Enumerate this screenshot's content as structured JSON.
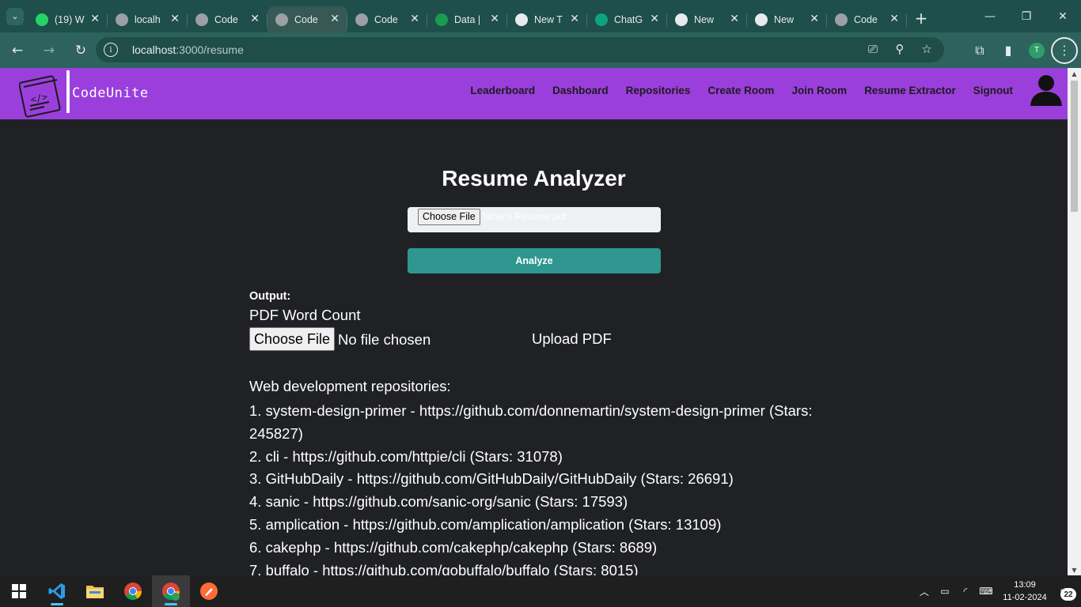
{
  "browser": {
    "tabs": [
      {
        "title": "(19) W",
        "favicon_color": "#25d366",
        "icon": "whatsapp-icon"
      },
      {
        "title": "localh",
        "favicon_color": "#9aa0a6",
        "icon": "globe-icon"
      },
      {
        "title": "Code",
        "favicon_color": "#9aa0a6",
        "icon": "globe-icon"
      },
      {
        "title": "Code",
        "favicon_color": "#9aa0a6",
        "icon": "globe-icon",
        "active": true
      },
      {
        "title": "Code",
        "favicon_color": "#9aa0a6",
        "icon": "globe-icon"
      },
      {
        "title": "Data |",
        "favicon_color": "#1a9c4d",
        "icon": "mongodb-leaf-icon"
      },
      {
        "title": "New T",
        "favicon_color": "#e8eaed",
        "icon": "chrome-icon"
      },
      {
        "title": "ChatG",
        "favicon_color": "#10a37f",
        "icon": "chatgpt-icon"
      },
      {
        "title": "New",
        "favicon_color": "#e8eaed",
        "icon": "chrome-icon"
      },
      {
        "title": "New",
        "favicon_color": "#e8eaed",
        "icon": "chrome-icon"
      },
      {
        "title": "Code",
        "favicon_color": "#9aa0a6",
        "icon": "globe-icon"
      }
    ],
    "url_host": "localhost",
    "url_path": ":3000/resume",
    "profile_initial": "T"
  },
  "app": {
    "brand": "CodeUnite",
    "nav_links": [
      "Leaderboard",
      "Dashboard",
      "Repositories",
      "Create Room",
      "Join Room",
      "Resume Extractor",
      "Signout"
    ],
    "accent_color": "#9b3fdc"
  },
  "page": {
    "title": "Resume Analyzer",
    "file_button_label": "Choose File",
    "selected_file": "Taher's Resume.pdf",
    "analyze_label": "Analyze",
    "analyze_color": "#2f9690",
    "output_label": "Output:",
    "word_count_title": "PDF Word Count",
    "second_file_button_label": "Choose File",
    "no_file_text": "No file chosen",
    "upload_label": "Upload PDF",
    "repos_heading": "Web development repositories:",
    "repos": [
      "1. system-design-primer - https://github.com/donnemartin/system-design-primer (Stars: 245827)",
      "2. cli - https://github.com/httpie/cli (Stars: 31078)",
      "3. GitHubDaily - https://github.com/GitHubDaily/GitHubDaily (Stars: 26691)",
      "4. sanic - https://github.com/sanic-org/sanic (Stars: 17593)",
      "5. amplication - https://github.com/amplication/amplication (Stars: 13109)",
      "6. cakephp - https://github.com/cakephp/cakephp (Stars: 8689)",
      "7. buffalo - https://github.com/gobuffalo/buffalo (Stars: 8015)"
    ]
  },
  "taskbar": {
    "time": "13:09",
    "date": "11-02-2024",
    "notification_count": "22"
  }
}
